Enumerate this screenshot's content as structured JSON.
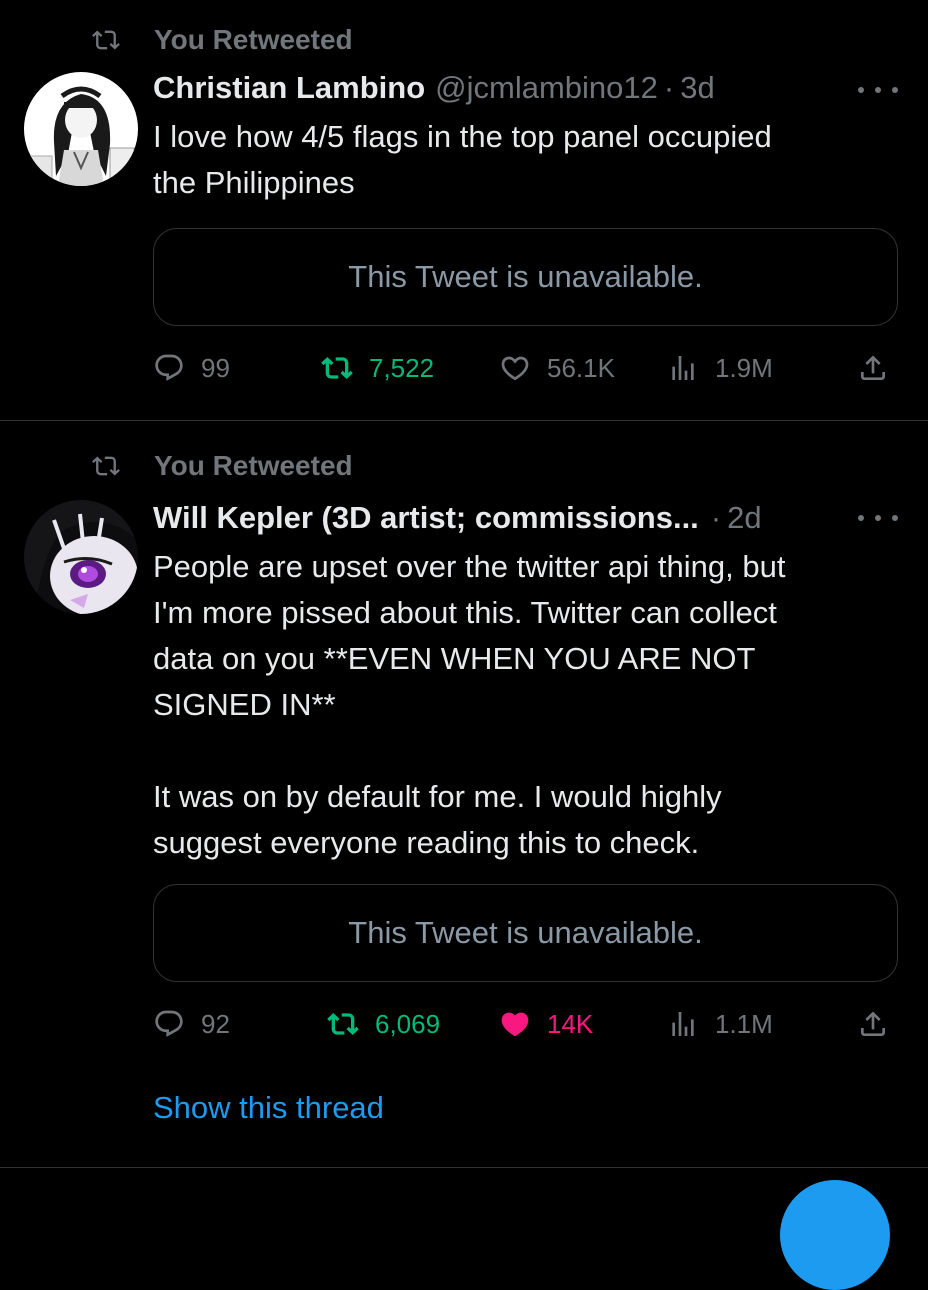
{
  "colors": {
    "background": "#000000",
    "text_primary": "#e7e9ea",
    "text_secondary": "#71767b",
    "border": "#2f3336",
    "retweet_green": "#00ba7c",
    "like_pink": "#f91880",
    "link_blue": "#1d9bf0"
  },
  "timeline": {
    "tweets": [
      {
        "social_context": "You Retweeted",
        "author": {
          "display_name": "Christian Lambino",
          "handle": "@jcmlambino12",
          "avatar_icon": "anime-avatar-icon"
        },
        "separator": "·",
        "time": "3d",
        "text": "I love how 4/5 flags in the top panel occupied\nthe Philippines",
        "quote_text": "This Tweet is unavailable.",
        "metrics": {
          "replies": "99",
          "retweets": "7,522",
          "likes": "56.1K",
          "views": "1.9M"
        },
        "retweeted": true,
        "liked": false
      },
      {
        "social_context": "You Retweeted",
        "author": {
          "display_name": "Will Kepler (3D artist; commissions...",
          "handle": "",
          "avatar_icon": "anime-avatar-icon"
        },
        "separator": "·",
        "time": "2d",
        "text": "People are upset over the twitter api thing, but\nI'm more pissed about this. Twitter can collect\ndata on you **EVEN WHEN YOU ARE NOT\nSIGNED IN**\n\nIt was on by default for me. I would highly\nsuggest everyone reading this to check.",
        "quote_text": "This Tweet is unavailable.",
        "metrics": {
          "replies": "92",
          "retweets": "6,069",
          "likes": "14K",
          "views": "1.1M"
        },
        "retweeted": true,
        "liked": true,
        "show_thread": "Show this thread"
      }
    ]
  }
}
